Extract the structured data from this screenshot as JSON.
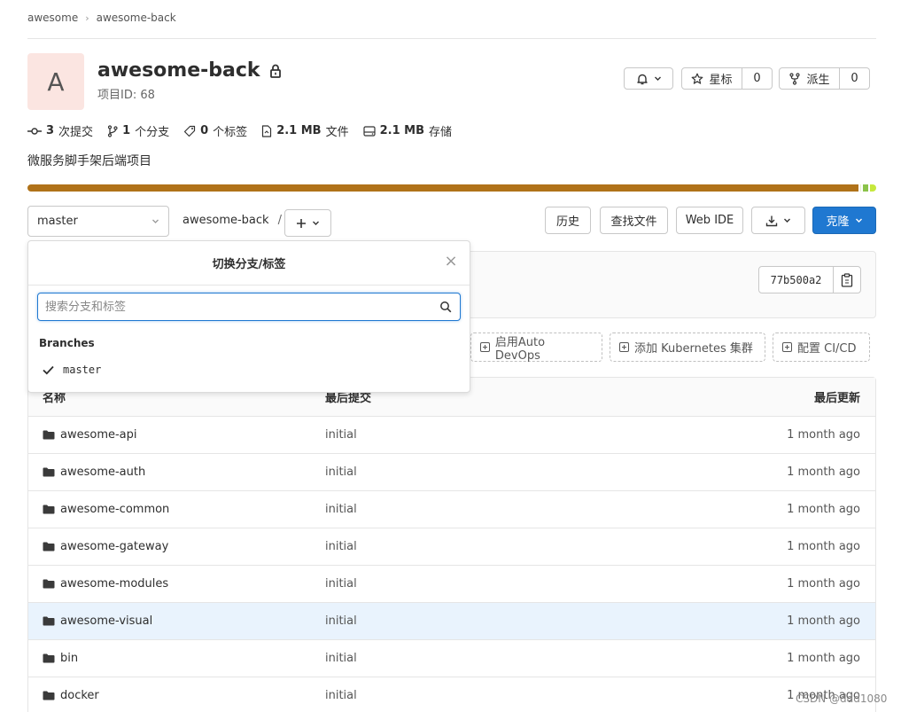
{
  "breadcrumb": {
    "group": "awesome",
    "project": "awesome-back"
  },
  "project": {
    "avatar_letter": "A",
    "name": "awesome-back",
    "id_label": "项目ID: 68",
    "description": "微服务脚手架后端项目"
  },
  "actions": {
    "star_label": "星标",
    "star_count": "0",
    "fork_label": "派生",
    "fork_count": "0"
  },
  "stats": {
    "commits_num": "3",
    "commits_label": "次提交",
    "branches_num": "1",
    "branches_label": "个分支",
    "tags_num": "0",
    "tags_label": "个标签",
    "files_num": "2.1 MB",
    "files_label": "文件",
    "storage_num": "2.1 MB",
    "storage_label": "存储"
  },
  "language_bar": [
    {
      "color": "#b07219",
      "share": 98.5
    },
    {
      "color": "#e6f2cc",
      "share": 0.1
    },
    {
      "color": "#8bc34a",
      "share": 0.7
    },
    {
      "color": "#c6e83c",
      "share": 0.7
    }
  ],
  "toolbar": {
    "branch": "master",
    "path": "awesome-back",
    "slash": "/",
    "history": "历史",
    "find_file": "查找文件",
    "web_ide": "Web IDE",
    "clone": "克隆"
  },
  "commit": {
    "sha": "77b500a2"
  },
  "quick_actions": {
    "auto_devops": "启用Auto DevOps",
    "kubernetes": "添加 Kubernetes 集群",
    "cicd": "配置 CI/CD"
  },
  "table": {
    "headers": {
      "name": "名称",
      "commit": "最后提交",
      "updated": "最后更新"
    },
    "rows": [
      {
        "name": "awesome-api",
        "commit": "initial",
        "updated": "1 month ago"
      },
      {
        "name": "awesome-auth",
        "commit": "initial",
        "updated": "1 month ago"
      },
      {
        "name": "awesome-common",
        "commit": "initial",
        "updated": "1 month ago"
      },
      {
        "name": "awesome-gateway",
        "commit": "initial",
        "updated": "1 month ago"
      },
      {
        "name": "awesome-modules",
        "commit": "initial",
        "updated": "1 month ago"
      },
      {
        "name": "awesome-visual",
        "commit": "initial",
        "updated": "1 month ago"
      },
      {
        "name": "bin",
        "commit": "initial",
        "updated": "1 month ago"
      },
      {
        "name": "docker",
        "commit": "initial",
        "updated": "1 month ago"
      }
    ]
  },
  "dropdown": {
    "title": "切换分支/标签",
    "search_placeholder": "搜索分支和标签",
    "section_label": "Branches",
    "items": [
      "master"
    ]
  },
  "watermark": "CSDN @ddd1080"
}
